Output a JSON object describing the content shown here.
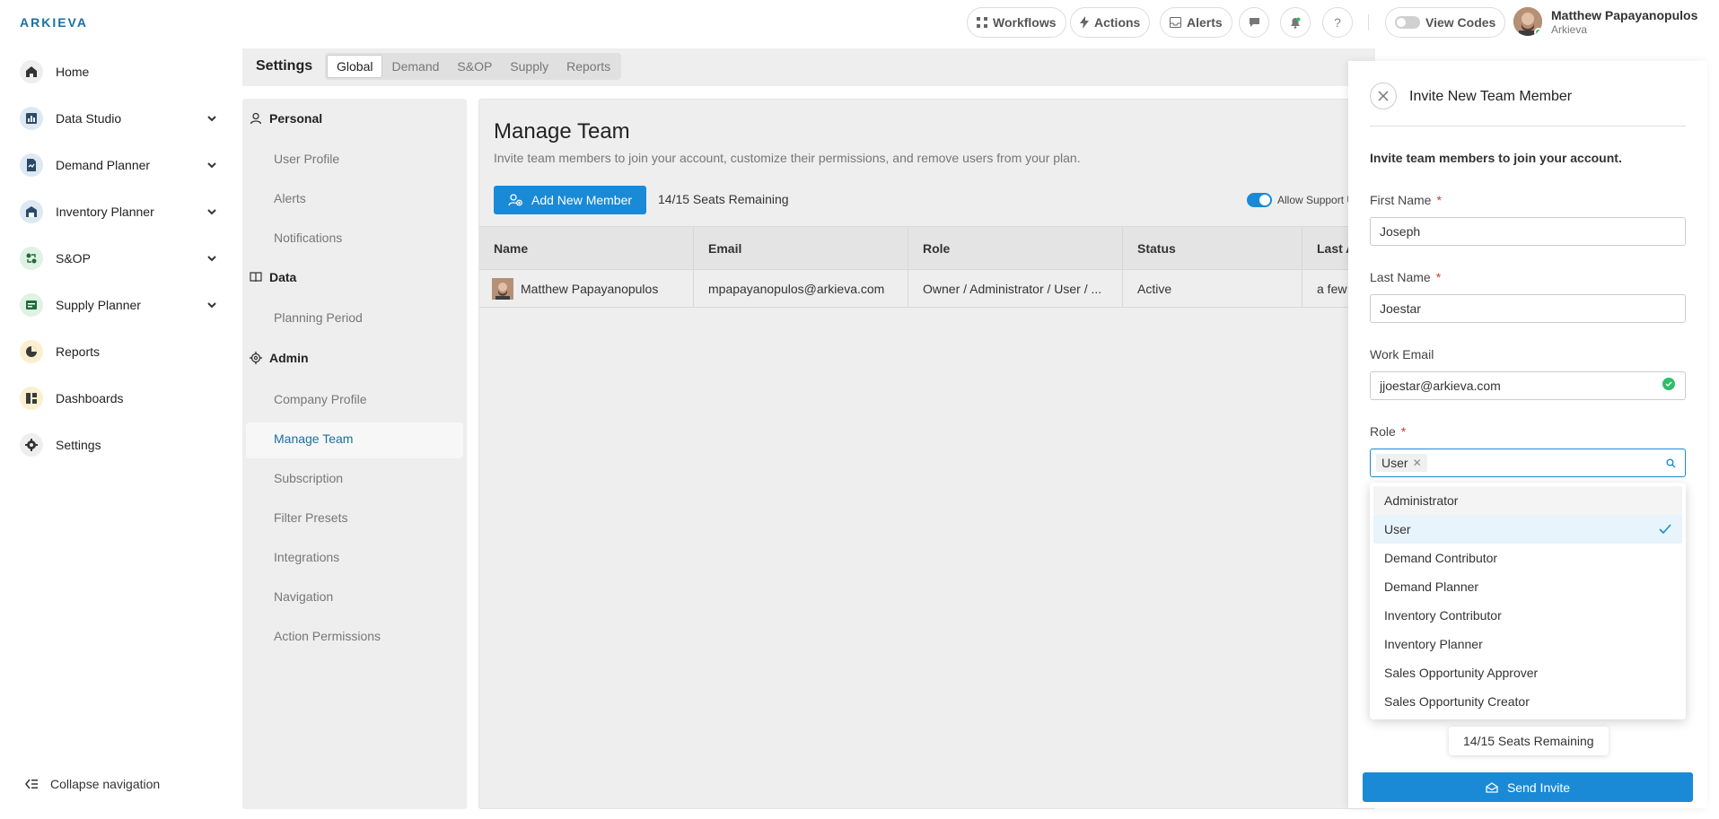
{
  "app": {
    "logo": "ARKIEVA"
  },
  "topbar": {
    "workflows": "Workflows",
    "actions": "Actions",
    "alerts": "Alerts",
    "help": "?",
    "view_codes": "View Codes",
    "user_name": "Matthew Papayanopulos",
    "user_org": "Arkieva"
  },
  "sidebar": {
    "items": [
      {
        "label": "Home",
        "icon": "home-icon",
        "expandable": false
      },
      {
        "label": "Data Studio",
        "icon": "chart-icon",
        "expandable": true
      },
      {
        "label": "Demand Planner",
        "icon": "document-icon",
        "expandable": true
      },
      {
        "label": "Inventory Planner",
        "icon": "warehouse-icon",
        "expandable": true
      },
      {
        "label": "S&OP",
        "icon": "cycle-icon",
        "expandable": true
      },
      {
        "label": "Supply Planner",
        "icon": "truck-icon",
        "expandable": true
      },
      {
        "label": "Reports",
        "icon": "pie-icon",
        "expandable": false
      },
      {
        "label": "Dashboards",
        "icon": "dashboard-icon",
        "expandable": false
      },
      {
        "label": "Settings",
        "icon": "gear-icon",
        "expandable": false
      }
    ],
    "collapse": "Collapse navigation"
  },
  "settings": {
    "title": "Settings",
    "tabs": [
      "Global",
      "Demand",
      "S&OP",
      "Supply",
      "Reports"
    ],
    "active_tab": "Global"
  },
  "settings_nav": {
    "personal": "Personal",
    "personal_items": [
      "User Profile",
      "Alerts",
      "Notifications"
    ],
    "data": "Data",
    "data_items": [
      "Planning Period"
    ],
    "admin": "Admin",
    "admin_items": [
      "Company Profile",
      "Manage Team",
      "Subscription",
      "Filter Presets",
      "Integrations",
      "Navigation",
      "Action Permissions"
    ],
    "active_item": "Manage Team"
  },
  "main": {
    "title": "Manage Team",
    "subtitle": "Invite team members to join your account, customize their permissions, and remove users from your plan.",
    "add_button": "Add New Member",
    "seats": "14/15 Seats Remaining",
    "allow_support": "Allow Support U",
    "columns": [
      "Name",
      "Email",
      "Role",
      "Status",
      "Last A"
    ],
    "rows": [
      {
        "name": "Matthew Papayanopulos",
        "email": "mpapayanopulos@arkieva.com",
        "role": "Owner / Administrator / User / ...",
        "status": "Active",
        "last": "a few"
      }
    ]
  },
  "invite": {
    "title": "Invite New Team Member",
    "intro": "Invite team members to join your account.",
    "first_name_label": "First Name",
    "first_name_value": "Joseph",
    "last_name_label": "Last Name",
    "last_name_value": "Joestar",
    "email_label": "Work Email",
    "email_value": "jjoestar@arkieva.com",
    "role_label": "Role",
    "role_selected": "User",
    "role_options": [
      "Administrator",
      "User",
      "Demand Contributor",
      "Demand Planner",
      "Inventory Contributor",
      "Inventory Planner",
      "Sales Opportunity Approver",
      "Sales Opportunity Creator"
    ],
    "tooltip": "14/15 Seats Remaining",
    "send_button": "Send Invite"
  },
  "colors": {
    "accent": "#1a8ad6",
    "logo": "#1a6fa3",
    "success": "#2fbe6a",
    "required": "#dd3333"
  }
}
